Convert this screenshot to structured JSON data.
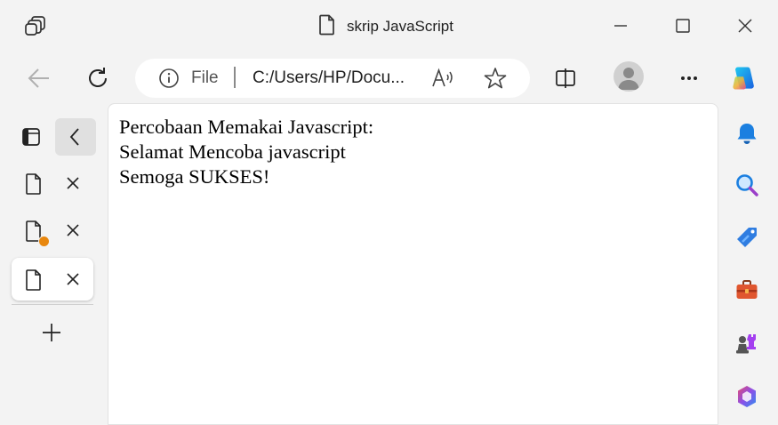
{
  "window": {
    "title": "skrip JavaScript"
  },
  "toolbar": {
    "address": {
      "scheme_label": "File",
      "url": "C:/Users/HP/Docu..."
    }
  },
  "vertical_tabs": {
    "tabs": [
      {
        "has_notification_dot": false,
        "active": false
      },
      {
        "has_notification_dot": true,
        "active": false
      },
      {
        "has_notification_dot": false,
        "active": true
      }
    ]
  },
  "page": {
    "lines": [
      "Percobaan Memakai Javascript:",
      "Selamat Mencoba javascript",
      "Semoga SUKSES!"
    ]
  },
  "sidebar": {
    "icons": [
      "bell-icon",
      "search-icon",
      "shopping-tag-icon",
      "tools-icon",
      "games-icon",
      "office-icon"
    ]
  },
  "colors": {
    "chrome_background": "#f3f3f3",
    "notification_dot": "#e8870e",
    "bell": "#1b7fe0",
    "copilot_blue": "#1a8ee8"
  }
}
